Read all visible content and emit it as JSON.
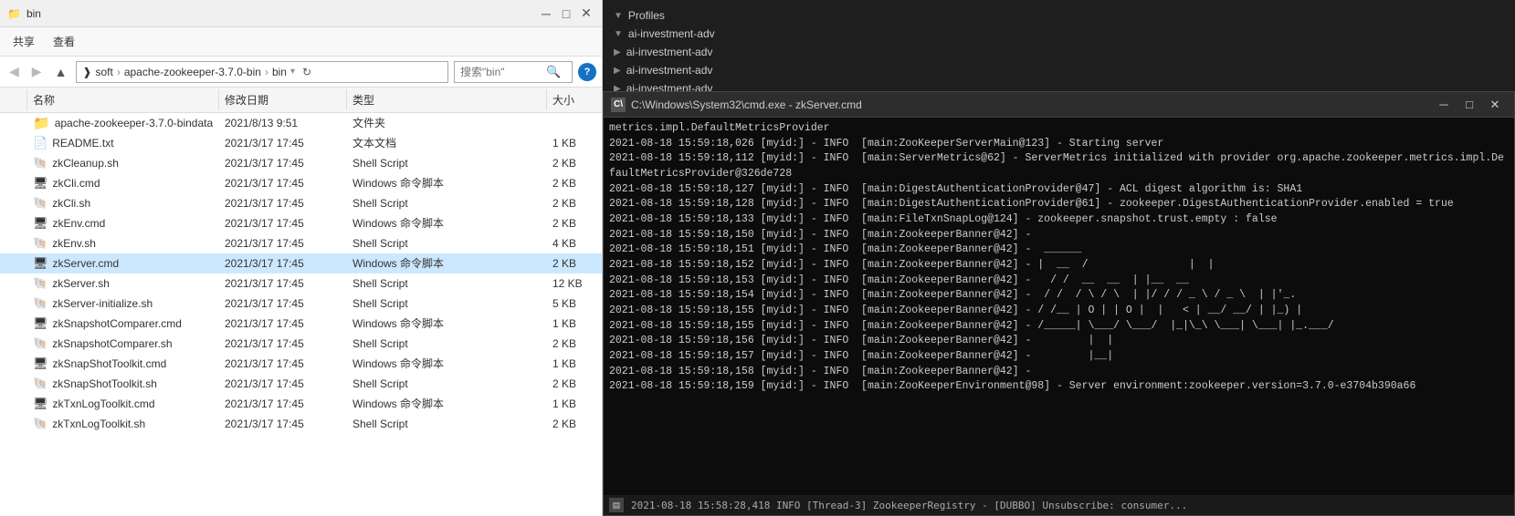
{
  "window": {
    "title": "bin",
    "toolbar_items": [
      "共享",
      "查看"
    ]
  },
  "address": {
    "path_segments": [
      "soft",
      "apache-zookeeper-3.7.0-bin",
      "bin"
    ],
    "search_placeholder": "搜索\"bin\"",
    "refresh_label": "↻"
  },
  "columns": {
    "name": "名称",
    "modified": "修改日期",
    "type": "类型",
    "size": "大小"
  },
  "files": [
    {
      "name": "apache-zookeeper-3.7.0-bindata",
      "modified": "2021/8/13 9:51",
      "type": "文件夹",
      "size": "",
      "icon": "folder"
    },
    {
      "name": "README.txt",
      "modified": "2021/3/17 17:45",
      "type": "文本文档",
      "size": "1 KB",
      "icon": "doc"
    },
    {
      "name": "zkCleanup.sh",
      "modified": "2021/3/17 17:45",
      "type": "Shell Script",
      "size": "2 KB",
      "icon": "shell"
    },
    {
      "name": "zkCli.cmd",
      "modified": "2021/3/17 17:45",
      "type": "Windows 命令脚本",
      "size": "2 KB",
      "icon": "cmd"
    },
    {
      "name": "zkCli.sh",
      "modified": "2021/3/17 17:45",
      "type": "Shell Script",
      "size": "2 KB",
      "icon": "shell"
    },
    {
      "name": "zkEnv.cmd",
      "modified": "2021/3/17 17:45",
      "type": "Windows 命令脚本",
      "size": "2 KB",
      "icon": "cmd"
    },
    {
      "name": "zkEnv.sh",
      "modified": "2021/3/17 17:45",
      "type": "Shell Script",
      "size": "4 KB",
      "icon": "shell"
    },
    {
      "name": "zkServer.cmd",
      "modified": "2021/3/17 17:45",
      "type": "Windows 命令脚本",
      "size": "2 KB",
      "icon": "cmd"
    },
    {
      "name": "zkServer.sh",
      "modified": "2021/3/17 17:45",
      "type": "Shell Script",
      "size": "12 KB",
      "icon": "shell"
    },
    {
      "name": "zkServer-initialize.sh",
      "modified": "2021/3/17 17:45",
      "type": "Shell Script",
      "size": "5 KB",
      "icon": "shell"
    },
    {
      "name": "zkSnapshotComparer.cmd",
      "modified": "2021/3/17 17:45",
      "type": "Windows 命令脚本",
      "size": "1 KB",
      "icon": "cmd"
    },
    {
      "name": "zkSnapshotComparer.sh",
      "modified": "2021/3/17 17:45",
      "type": "Shell Script",
      "size": "2 KB",
      "icon": "shell"
    },
    {
      "name": "zkSnapShotToolkit.cmd",
      "modified": "2021/3/17 17:45",
      "type": "Windows 命令脚本",
      "size": "1 KB",
      "icon": "cmd"
    },
    {
      "name": "zkSnapShotToolkit.sh",
      "modified": "2021/3/17 17:45",
      "type": "Shell Script",
      "size": "2 KB",
      "icon": "shell"
    },
    {
      "name": "zkTxnLogToolkit.cmd",
      "modified": "2021/3/17 17:45",
      "type": "Windows 命令脚本",
      "size": "1 KB",
      "icon": "cmd"
    },
    {
      "name": "zkTxnLogToolkit.sh",
      "modified": "2021/3/17 17:45",
      "type": "Shell Script",
      "size": "2 KB",
      "icon": "shell"
    }
  ],
  "vscode": {
    "items": [
      {
        "label": "Profiles",
        "expanded": true
      },
      {
        "label": "ai-investment-adv",
        "expanded": true
      },
      {
        "label": "ai-investment-adv",
        "expanded": false
      },
      {
        "label": "ai-investment-adv",
        "expanded": false
      },
      {
        "label": "ai-investment-adv",
        "expanded": false
      }
    ]
  },
  "cmd": {
    "title": "C:\\Windows\\System32\\cmd.exe - zkServer.cmd",
    "lines": [
      "metrics.impl.DefaultMetricsProvider",
      "2021-08-18 15:59:18,026 [myid:] - INFO  [main:ZooKeeperServerMain@123] - Starting server",
      "2021-08-18 15:59:18,112 [myid:] - INFO  [main:ServerMetrics@62] - ServerMetrics initialized with provider org.apache.zookeeper.metrics.impl.DefaultMetricsProvider@326de728",
      "2021-08-18 15:59:18,127 [myid:] - INFO  [main:DigestAuthenticationProvider@47] - ACL digest algorithm is: SHA1",
      "2021-08-18 15:59:18,128 [myid:] - INFO  [main:DigestAuthenticationProvider@61] - zookeeper.DigestAuthenticationProvider.enabled = true",
      "2021-08-18 15:59:18,133 [myid:] - INFO  [main:FileTxnSnapLog@124] - zookeeper.snapshot.trust.empty : false",
      "2021-08-18 15:59:18,150 [myid:] - INFO  [main:ZookeeperBanner@42] -",
      "2021-08-18 15:59:18,151 [myid:] - INFO  [main:ZookeeperBanner@42] -  ______",
      "2021-08-18 15:59:18,152 [myid:] - INFO  [main:ZookeeperBanner@42] - |  __  /                |  |",
      "2021-08-18 15:59:18,153 [myid:] - INFO  [main:ZookeeperBanner@42] -   / /  __  __  | |__  __",
      "2021-08-18 15:59:18,154 [myid:] - INFO  [main:ZookeeperBanner@42] -  / /  / \\ / \\  | |/ / / _ \\ / _ \\  | |'_.",
      "2021-08-18 15:59:18,155 [myid:] - INFO  [main:ZookeeperBanner@42] - / /__ | O | | O |  |   < | __/ __/ | |_) |",
      "2021-08-18 15:59:18,155 [myid:] - INFO  [main:ZookeeperBanner@42] - /_____| \\___/ \\___/  |_|\\_\\ \\___| \\___| |_.___/",
      "2021-08-18 15:59:18,156 [myid:] - INFO  [main:ZookeeperBanner@42] -         |  |",
      "2021-08-18 15:59:18,157 [myid:] - INFO  [main:ZookeeperBanner@42] -         |__|",
      "2021-08-18 15:59:18,158 [myid:] - INFO  [main:ZookeeperBanner@42] -",
      "2021-08-18 15:59:18,159 [myid:] - INFO  [main:ZooKeeperEnvironment@98] - Server environment:zookeeper.version=3.7.0-e3704b390a66"
    ]
  },
  "status_bar": {
    "text": "2021-08-18 15:58:28,418 INFO  [Thread-3] ZookeeperRegistry - [DUBBO] Unsubscribe: consumer..."
  }
}
